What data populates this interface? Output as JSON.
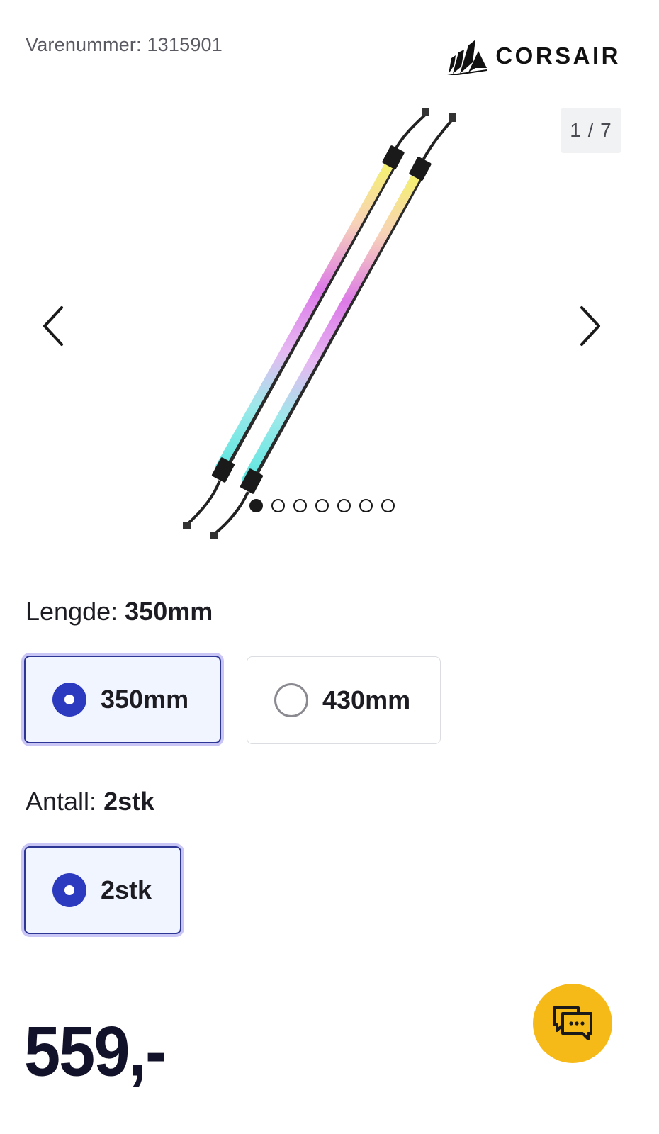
{
  "product": {
    "sku_label": "Varenummer: 1315901",
    "brand": "CORSAIR"
  },
  "gallery": {
    "counter": "1 / 7",
    "total_images": 7,
    "active_index": 0,
    "prev_icon": "chevron-left-icon",
    "next_icon": "chevron-right-icon"
  },
  "length": {
    "label": "Lengde:",
    "selected": "350mm",
    "options": [
      {
        "label": "350mm",
        "selected": true
      },
      {
        "label": "430mm",
        "selected": false
      }
    ]
  },
  "quantity": {
    "label": "Antall:",
    "selected": "2stk",
    "options": [
      {
        "label": "2stk",
        "selected": true
      }
    ]
  },
  "price": "559,-",
  "chat": {
    "icon": "chat-icon",
    "color": "#f5b918"
  },
  "colors": {
    "accent": "#2c3ac0",
    "selected_bg": "#f1f5ff",
    "price": "#12122a"
  }
}
